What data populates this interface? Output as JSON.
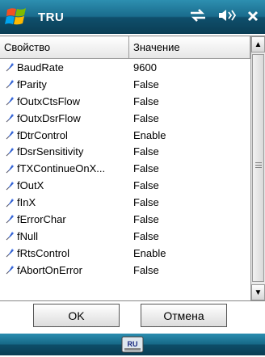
{
  "titlebar": {
    "title": "TRU"
  },
  "list": {
    "headers": {
      "property": "Свойство",
      "value": "Значение"
    },
    "rows": [
      {
        "name": "BaudRate",
        "value": "9600"
      },
      {
        "name": "fParity",
        "value": "False"
      },
      {
        "name": "fOutxCtsFlow",
        "value": "False"
      },
      {
        "name": "fOutxDsrFlow",
        "value": "False"
      },
      {
        "name": "fDtrControl",
        "value": "Enable"
      },
      {
        "name": "fDsrSensitivity",
        "value": "False"
      },
      {
        "name": "fTXContinueOnX...",
        "value": "False"
      },
      {
        "name": "fOutX",
        "value": "False"
      },
      {
        "name": "fInX",
        "value": "False"
      },
      {
        "name": "fErrorChar",
        "value": "False"
      },
      {
        "name": "fNull",
        "value": "False"
      },
      {
        "name": "fRtsControl",
        "value": "Enable"
      },
      {
        "name": "fAbortOnError",
        "value": "False"
      }
    ]
  },
  "buttons": {
    "ok": "OK",
    "cancel": "Отмена"
  },
  "softbar": {
    "sip_label": "RU"
  },
  "colors": {
    "titlebar": "#1a6c8d",
    "pin": "#2f5fd0"
  }
}
